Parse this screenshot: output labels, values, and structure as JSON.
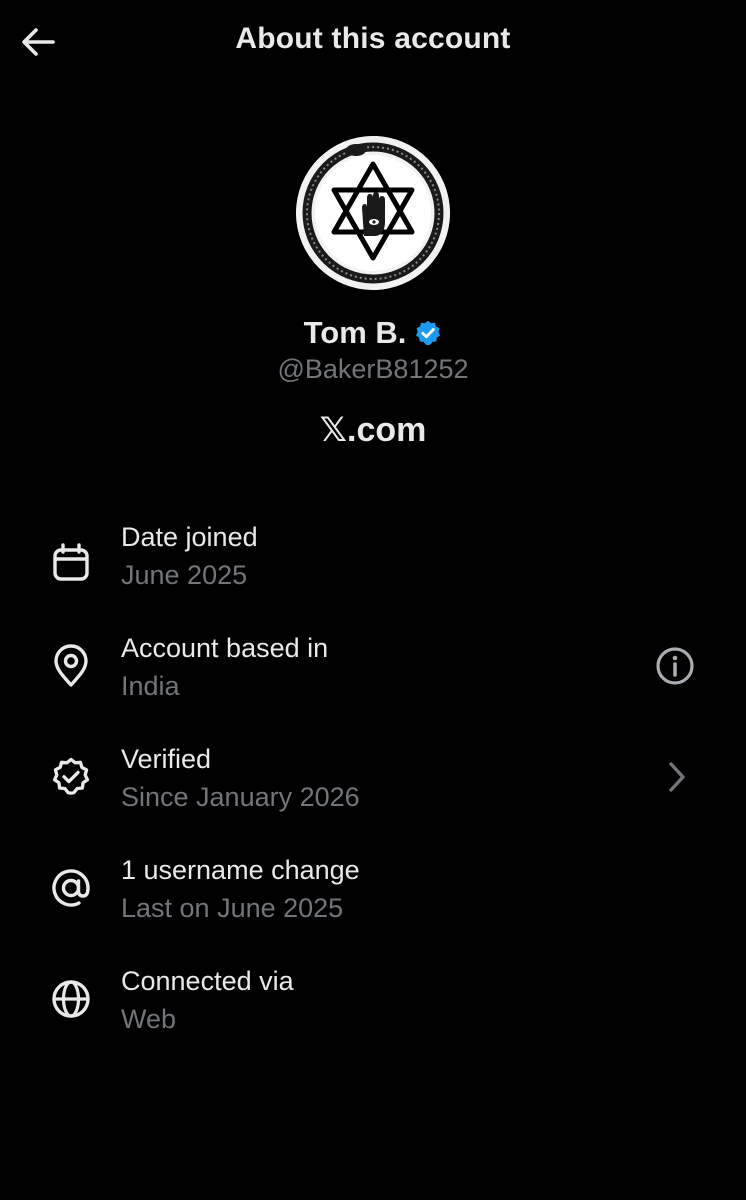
{
  "header": {
    "title": "About this account",
    "back_icon": "arrow-left-icon"
  },
  "profile": {
    "display_name": "Tom B.",
    "handle": "@BakerB81252",
    "verified_badge_icon": "verified-check-icon",
    "site_prefix": "𝕏",
    "site_suffix": ".com",
    "avatar_description_icon": "hexagram-hand-ouroboros-avatar"
  },
  "details": [
    {
      "icon": "calendar-icon",
      "title": "Date joined",
      "subtitle": "June 2025"
    },
    {
      "icon": "location-pin-icon",
      "title": "Account based in",
      "subtitle": "India",
      "action_icon": "info-icon"
    },
    {
      "icon": "verified-badge-outline-icon",
      "title": "Verified",
      "subtitle": "Since January 2026",
      "action_icon": "chevron-right-icon"
    },
    {
      "icon": "at-sign-icon",
      "title": "1 username change",
      "subtitle": "Last on June 2025"
    },
    {
      "icon": "globe-icon",
      "title": "Connected via",
      "subtitle": "Web"
    }
  ],
  "colors": {
    "background": "#000000",
    "primary_text": "#e7e9ea",
    "secondary_text": "#71767b",
    "verified_blue": "#1d9bf0"
  }
}
